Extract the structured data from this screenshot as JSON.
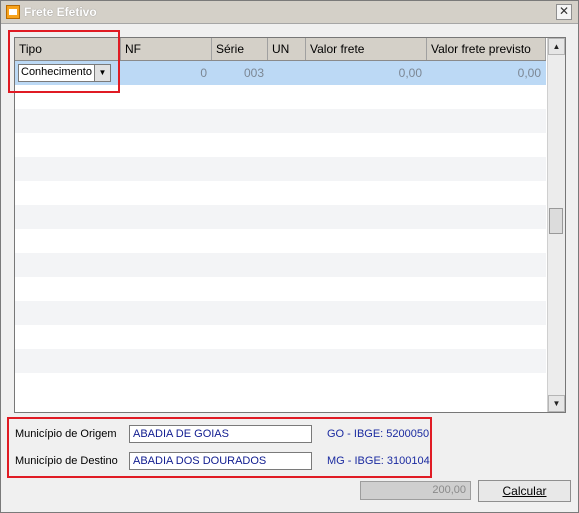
{
  "window": {
    "title": "Frete Efetivo"
  },
  "grid": {
    "columns": [
      "Tipo",
      "NF",
      "Série",
      "UN",
      "Valor frete",
      "Valor frete previsto"
    ],
    "row": {
      "tipo": "Conhecimento",
      "nf": "0",
      "serie": "003",
      "un": "",
      "valor_frete": "0,00",
      "valor_frete_previsto": "0,00"
    }
  },
  "municipio": {
    "origem_label": "Município de Origem",
    "origem_value": "ABADIA DE GOIAS",
    "origem_ibge": "GO - IBGE: 5200050",
    "destino_label": "Município de Destino",
    "destino_value": "ABADIA DOS DOURADOS",
    "destino_ibge": "MG - IBGE: 3100104"
  },
  "totals": {
    "value": "200,00"
  },
  "buttons": {
    "calcular": "Calcular"
  },
  "colors": {
    "highlight": "#e01b24",
    "selected_row": "#bcd9f5",
    "ibge_text": "#1a2aa0"
  }
}
